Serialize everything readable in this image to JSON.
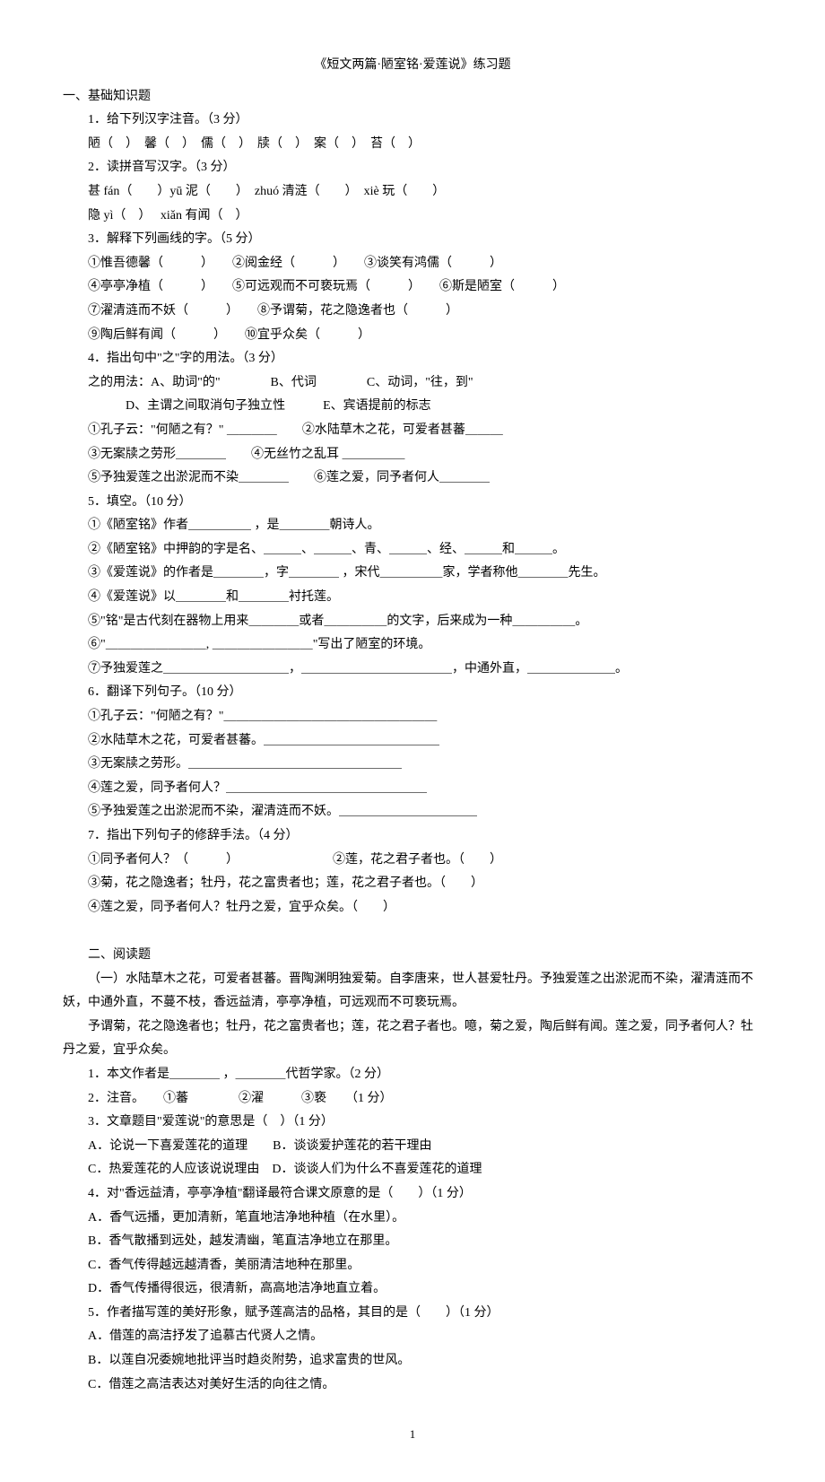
{
  "title": "《短文两篇·陋室铭·爱莲说》练习题",
  "section1": "一、基础知识题",
  "q1_label": "1．给下列汉字注音。（3 分）",
  "q1_line": "陋（　）　馨（　）　儒（　）　牍（　）　案（　）　苔（　）",
  "q2_label": "2．读拼音写汉字。（3 分）",
  "q2_line1": "甚 fán（　　）yū 泥（　　）　zhuó 清涟（　　）　xiè 玩（　　）",
  "q2_line2": "隐 yì（　）　 xiǎn 有闻（　）",
  "q3_label": "3．解释下列画线的字。（5 分）",
  "q3_1": "①惟吾德馨（　　　）　　②阅金经（　　　）　　③谈笑有鸿儒（　　　）",
  "q3_2": "④亭亭净植（　　　）　　⑤可远观而不可亵玩焉（　　　）　　⑥斯是陋室（　　　）",
  "q3_3": "⑦濯清涟而不妖（　　　）　　⑧予谓菊，花之隐逸者也（　　　）",
  "q3_4": "⑨陶后鲜有闻（　　　）　　⑩宜乎众矣（　　　）",
  "q4_label": "4．指出句中\"之\"字的用法。（3 分）",
  "q4_opts1": "之的用法：A、助词\"的\"　　　　B、代词　　　　C、动词，\"往，到\"",
  "q4_opts2": "　　　D、主谓之间取消句子独立性　　　E、宾语提前的标志",
  "q4_1": "①孔子云：\"何陋之有？\" ＿＿＿＿　　②水陆草木之花，可爱者甚蕃＿＿＿",
  "q4_2": "③无案牍之劳形＿＿＿＿　　④无丝竹之乱耳 ＿＿＿＿＿",
  "q4_3": "⑤予独爱莲之出淤泥而不染＿＿＿＿　　⑥莲之爱，同予者何人＿＿＿＿",
  "q5_label": "5．填空。（10 分）",
  "q5_1": "①《陋室铭》作者＿＿＿＿＿ ，是＿＿＿＿朝诗人。",
  "q5_2": "②《陋室铭》中押韵的字是名、＿＿＿、＿＿＿、青、＿＿＿、经、＿＿＿和＿＿＿。",
  "q5_3": "③《爱莲说》的作者是＿＿＿＿，字＿＿＿＿ ，宋代＿＿＿＿＿家，学者称他＿＿＿＿先生。",
  "q5_4": "④《爱莲说》以＿＿＿＿和＿＿＿＿衬托莲。",
  "q5_5": "⑤\"铭\"是古代刻在器物上用来＿＿＿＿或者＿＿＿＿＿的文字，后来成为一种＿＿＿＿＿。",
  "q5_6": "⑥\"＿＿＿＿＿＿＿＿, ＿＿＿＿＿＿＿＿\"写出了陋室的环境。",
  "q5_7": "⑦予独爱莲之＿＿＿＿＿＿＿＿＿＿，＿＿＿＿＿＿＿＿＿＿＿＿，中通外直，＿＿＿＿＿＿＿。",
  "q6_label": "6．翻译下列句子。（10 分）",
  "q6_1": "①孔子云：\"何陋之有？\"＿＿＿＿＿＿＿＿＿＿＿＿＿＿＿＿＿",
  "q6_2": "②水陆草木之花，可爱者甚蕃。＿＿＿＿＿＿＿＿＿＿＿＿＿＿",
  "q6_3": "③无案牍之劳形。＿＿＿＿＿＿＿＿＿＿＿＿＿＿＿＿＿",
  "q6_4": "④莲之爱，同予者何人？＿＿＿＿＿＿＿＿＿＿＿＿＿＿＿＿",
  "q6_5": "⑤予独爱莲之出淤泥而不染，濯清涟而不妖。＿＿＿＿＿＿＿＿＿＿＿",
  "q7_label": "7．指出下列句子的修辞手法。（4 分）",
  "q7_1": "①同予者何人？（　　　）　　　　　　　　②莲，花之君子者也。（　　）",
  "q7_2": "③菊，花之隐逸者；牡丹，花之富贵者也；莲，花之君子者也。（　　）",
  "q7_3": "④莲之爱，同予者何人？牡丹之爱，宜乎众矣。（　　）",
  "section2": "二、阅读题",
  "passage1": "（一）水陆草木之花，可爱者甚蕃。晋陶渊明独爱菊。自李唐来，世人甚爱牡丹。予独爱莲之出淤泥而不染，濯清涟而不妖，中通外直，不蔓不枝，香远益清，亭亭净植，可远观而不可亵玩焉。",
  "passage2": "予谓菊，花之隐逸者也；牡丹，花之富贵者也；莲，花之君子者也。噫，菊之爱，陶后鲜有闻。莲之爱，同予者何人？牡丹之爱，宜乎众矣。",
  "r1": "1．本文作者是＿＿＿＿ ，＿＿＿＿代哲学家。（2 分）",
  "r2": "2．注音。　　①蕃　　　　②濯　　　③亵　　（1 分）",
  "r3": "3．文章题目\"爱莲说\"的意思是（　）（1 分）",
  "r3a": "A．论说一下喜爱莲花的道理　　B．谈谈爱护莲花的若干理由",
  "r3b": "C．热爱莲花的人应该说说理由　D．谈谈人们为什么不喜爱莲花的道理",
  "r4": "4．对\"香远益清，亭亭净植\"翻译最符合课文原意的是（　　）（1 分）",
  "r4a": "A．香气远播，更加清新，笔直地洁净地种植（在水里）。",
  "r4b": "B．香气散播到远处，越发清幽，笔直洁净地立在那里。",
  "r4c": "C．香气传得越远越清香，美丽清洁地种在那里。",
  "r4d": "D．香气传播得很远，很清新，高高地洁净地直立着。",
  "r5": "5．作者描写莲的美好形象，赋予莲高洁的品格，其目的是（　　）（1 分）",
  "r5a": "A．借莲的高洁抒发了追慕古代贤人之情。",
  "r5b": "B．以莲自况委婉地批评当时趋炎附势，追求富贵的世风。",
  "r5c": "C．借莲之高洁表达对美好生活的向往之情。",
  "pagenum": "1"
}
